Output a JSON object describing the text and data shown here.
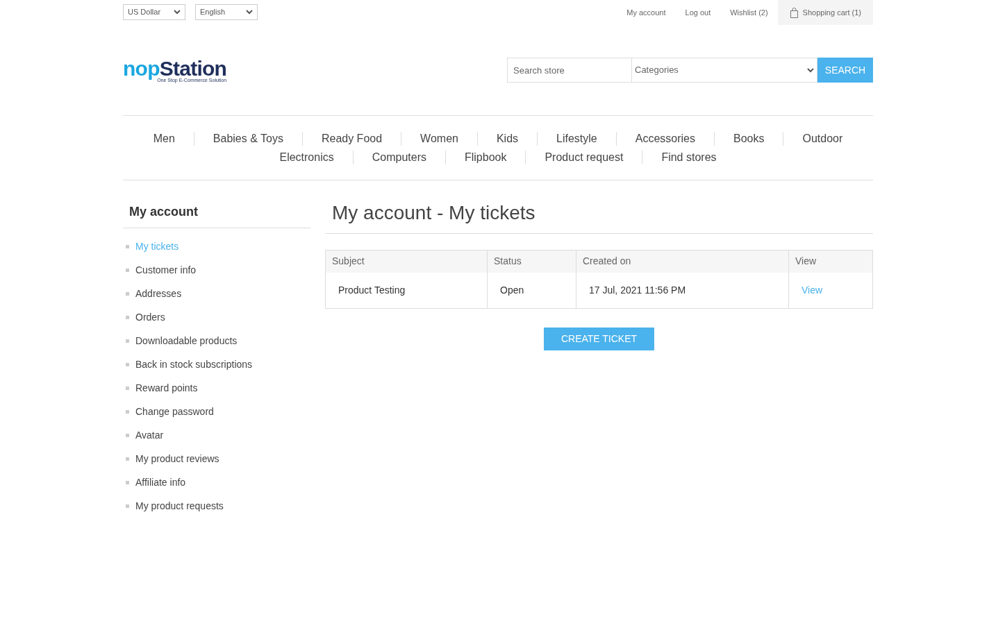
{
  "header_selectors": [
    {
      "value": "US Dollar"
    },
    {
      "value": "English"
    }
  ],
  "header_links": [
    {
      "label": "My account",
      "kind": "link"
    },
    {
      "label": "Log out",
      "kind": "link"
    },
    {
      "label": "Wishlist (2)",
      "kind": "link"
    },
    {
      "label": "Shopping cart (1)",
      "kind": "cart"
    }
  ],
  "logo": {
    "prefix": "nop",
    "name": "Station",
    "tagline": "One Stop E-Commerce Solution"
  },
  "search": {
    "placeholder": "Search store",
    "category": "Categories",
    "button": "SEARCH"
  },
  "menu": [
    [
      "Men",
      "Babies & Toys",
      "Ready Food",
      "Women",
      "Kids",
      "Lifestyle",
      "Accessories",
      "Books",
      "Outdoor"
    ],
    [
      "Electronics",
      "Computers",
      "Flipbook",
      "Product request",
      "Find stores"
    ]
  ],
  "sidebar": {
    "title": "My account",
    "items": [
      {
        "label": "My tickets",
        "selected": true
      },
      {
        "label": "Customer info",
        "selected": false
      },
      {
        "label": "Addresses",
        "selected": false
      },
      {
        "label": "Orders",
        "selected": false
      },
      {
        "label": "Downloadable products",
        "selected": false
      },
      {
        "label": "Back in stock subscriptions",
        "selected": false
      },
      {
        "label": "Reward points",
        "selected": false
      },
      {
        "label": "Change password",
        "selected": false
      },
      {
        "label": "Avatar",
        "selected": false
      },
      {
        "label": "My product reviews",
        "selected": false
      },
      {
        "label": "Affiliate info",
        "selected": false
      },
      {
        "label": "My product requests",
        "selected": false
      }
    ]
  },
  "page_title": "My account - My tickets",
  "table": {
    "columns": [
      "Subject",
      "Status",
      "Created on",
      "View"
    ],
    "rows": [
      {
        "subject": "Product Testing",
        "status": "Open",
        "created_on": "17 Jul, 2021 11:56 PM",
        "view": "View"
      }
    ]
  },
  "create_button": "CREATE TICKET"
}
